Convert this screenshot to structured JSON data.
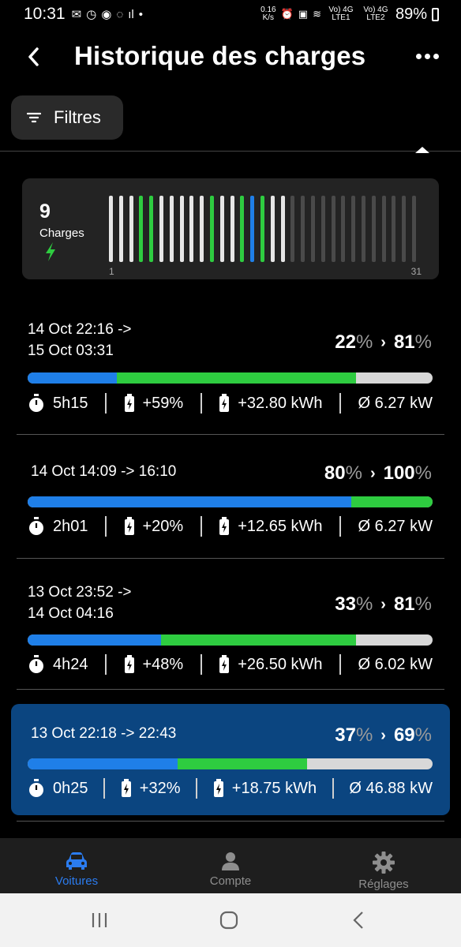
{
  "status_bar": {
    "time": "10:31",
    "net_speed_value": "0.16",
    "net_speed_unit": "K/s",
    "sim1": "Vo) 4G LTE1",
    "sim2": "Vo) 4G LTE2",
    "battery": "89%"
  },
  "header": {
    "title": "Historique des charges",
    "back_icon": "chevron-left-icon",
    "menu_icon": "more-horizontal-icon"
  },
  "filter": {
    "label": "Filtres",
    "icon": "filter-lines-icon"
  },
  "summary": {
    "count": "9",
    "count_label": "Charges",
    "bolt_color": "#2ecc40",
    "axis_start": "1",
    "axis_end": "31",
    "day_bars": [
      "light",
      "light",
      "light",
      "green",
      "green",
      "light",
      "light",
      "light",
      "light",
      "light",
      "green",
      "light",
      "light",
      "green",
      "blue",
      "green",
      "light",
      "light",
      "dark",
      "dark",
      "dark",
      "dark",
      "dark",
      "dark",
      "dark",
      "dark",
      "dark",
      "dark",
      "dark",
      "dark",
      "dark"
    ],
    "bar_colors": {
      "light": "#e6e6e6",
      "green": "#2ecc40",
      "blue": "#1f7fe8",
      "dark": "#4a4a4a"
    }
  },
  "sessions": [
    {
      "date_line1": "14 Oct 22:16 ->",
      "date_line2": "15 Oct 03:31",
      "start_pct": "22",
      "end_pct": "81",
      "unit": "%",
      "start_frac": 0.22,
      "end_frac": 0.81,
      "duration": "5h15",
      "gain_pct": "+59%",
      "energy": "+32.80 kWh",
      "avg_power": "Ø 6.27 kW",
      "selected": false
    },
    {
      "date_line1": "14 Oct 14:09 -> 16:10",
      "date_line2": "",
      "start_pct": "80",
      "end_pct": "100",
      "unit": "%",
      "start_frac": 0.8,
      "end_frac": 1.0,
      "duration": "2h01",
      "gain_pct": "+20%",
      "energy": "+12.65 kWh",
      "avg_power": "Ø 6.27 kW",
      "selected": false
    },
    {
      "date_line1": "13 Oct 23:52 ->",
      "date_line2": "14 Oct 04:16",
      "start_pct": "33",
      "end_pct": "81",
      "unit": "%",
      "start_frac": 0.33,
      "end_frac": 0.81,
      "duration": "4h24",
      "gain_pct": "+48%",
      "energy": "+26.50 kWh",
      "avg_power": "Ø 6.02 kW",
      "selected": false
    },
    {
      "date_line1": "13 Oct 22:18 -> 22:43",
      "date_line2": "",
      "start_pct": "37",
      "end_pct": "69",
      "unit": "%",
      "start_frac": 0.37,
      "end_frac": 0.69,
      "duration": "0h25",
      "gain_pct": "+32%",
      "energy": "+18.75 kWh",
      "avg_power": "Ø 46.88 kW",
      "selected": true
    }
  ],
  "colors": {
    "blue": "#1f7fe8",
    "green": "#2ecc40",
    "remaining": "#d8d8d8",
    "selected_bg": "#0b4580",
    "nav_active": "#2b7cf0"
  },
  "bottom_nav": {
    "items": [
      {
        "label": "Voitures",
        "icon": "car-icon",
        "active": true
      },
      {
        "label": "Compte",
        "icon": "person-icon",
        "active": false
      },
      {
        "label": "Réglages",
        "icon": "gear-icon",
        "active": false
      }
    ]
  }
}
